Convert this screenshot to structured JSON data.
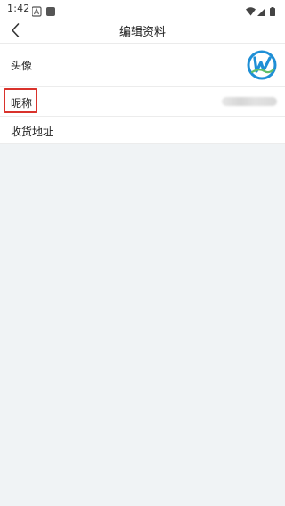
{
  "status_bar": {
    "time": "1:42",
    "left_icons": [
      "notification-a-icon",
      "app-square-icon"
    ],
    "right_icons": [
      "wifi-icon",
      "signal-icon",
      "battery-icon"
    ]
  },
  "header": {
    "title": "编辑资料",
    "back_icon": "chevron-left-icon"
  },
  "rows": {
    "avatar": {
      "label": "头像",
      "icon": "logo-avatar"
    },
    "nickname": {
      "label": "昵称",
      "value_state": "blurred",
      "highlight_color": "#d9322b"
    },
    "address": {
      "label": "收货地址"
    }
  },
  "colors": {
    "background": "#f0f3f5",
    "row_background": "#ffffff",
    "highlight": "#d9322b",
    "avatar_blue": "#1f8fd6",
    "avatar_green": "#5fbf6a"
  }
}
